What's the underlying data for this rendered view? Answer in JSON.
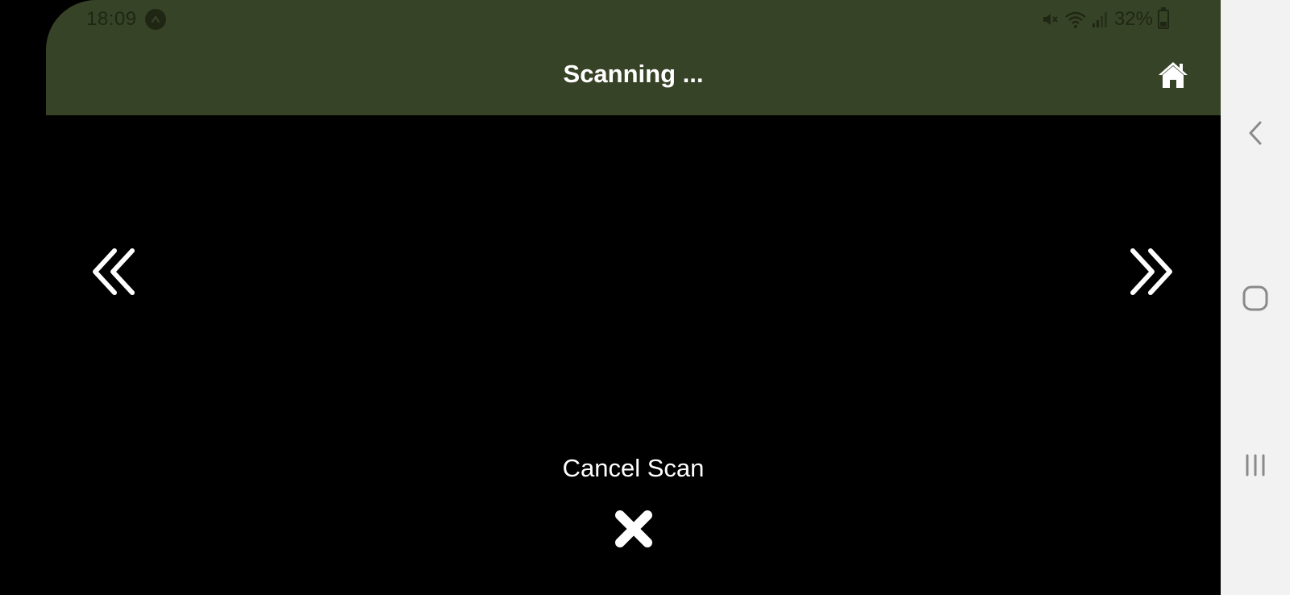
{
  "status_bar": {
    "time": "18:09",
    "battery": "32%",
    "icons": [
      "app-notification-icon",
      "mute-icon",
      "wifi-icon",
      "signal-icon",
      "battery-icon"
    ]
  },
  "app_bar": {
    "title": "Scanning ...",
    "home_icon": "home-icon"
  },
  "navigation": {
    "prev_icon": "double-chevron-left-icon",
    "next_icon": "double-chevron-right-icon"
  },
  "cancel": {
    "label": "Cancel Scan",
    "icon": "close-icon"
  },
  "system_nav": {
    "items": [
      "back-icon",
      "home-circle-icon",
      "recents-icon"
    ]
  },
  "colors": {
    "header_bg": "#374326",
    "status_text": "#1f2614",
    "content_bg": "#000000",
    "foreground": "#ffffff",
    "system_nav_bg": "#f2f2f2",
    "system_nav_icon": "#8a8a8a"
  }
}
